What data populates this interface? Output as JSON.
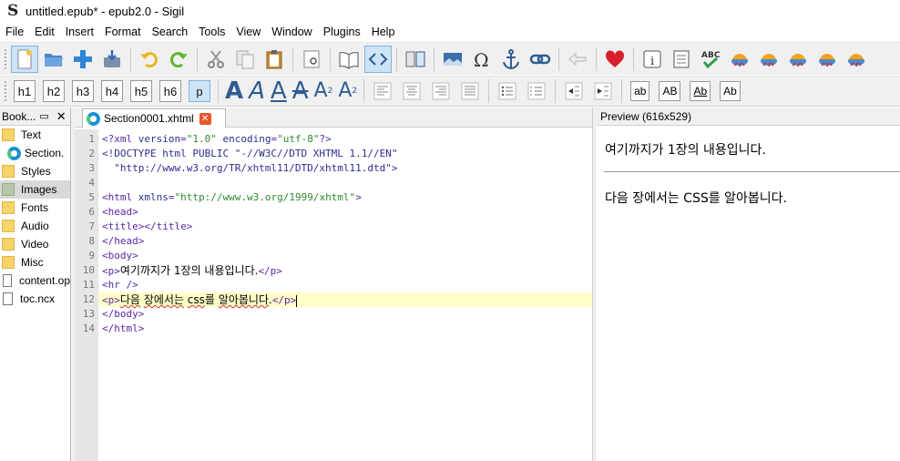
{
  "window": {
    "title": "untitled.epub* - epub2.0 - Sigil",
    "app_logo": "S"
  },
  "menu": [
    "File",
    "Edit",
    "Insert",
    "Format",
    "Search",
    "Tools",
    "View",
    "Window",
    "Plugins",
    "Help"
  ],
  "toolbar2": {
    "headings": [
      "h1",
      "h2",
      "h3",
      "h4",
      "h5",
      "h6",
      "p"
    ],
    "text_styles": [
      "A",
      "A",
      "A",
      "A",
      "A",
      "A"
    ],
    "subscript_mark": "2",
    "superscript_mark": "2",
    "case_buttons": [
      "ab",
      "AB",
      "Ab",
      "Ab"
    ]
  },
  "book_browser": {
    "title": "Book...",
    "items": [
      {
        "label": "Text",
        "kind": "folder"
      },
      {
        "label": "Section.",
        "kind": "xhtml"
      },
      {
        "label": "Styles",
        "kind": "folder"
      },
      {
        "label": "Images",
        "kind": "folder-selected"
      },
      {
        "label": "Fonts",
        "kind": "folder"
      },
      {
        "label": "Audio",
        "kind": "folder"
      },
      {
        "label": "Video",
        "kind": "folder"
      },
      {
        "label": "Misc",
        "kind": "folder"
      },
      {
        "label": "content.op",
        "kind": "file"
      },
      {
        "label": "toc.ncx",
        "kind": "file"
      }
    ]
  },
  "editor": {
    "tab_label": "Section0001.xhtml",
    "line_numbers": [
      "1",
      "2",
      "3",
      "4",
      "5",
      "6",
      "7",
      "8",
      "9",
      "10",
      "11",
      "12",
      "13",
      "14"
    ],
    "lines": {
      "l1": {
        "a": "<?xml ",
        "b": "version",
        "c": "=",
        "d": "\"1.0\"",
        "e": " ",
        "f": "encoding",
        "g": "=",
        "h": "\"utf-8\"",
        "i": "?>"
      },
      "l2": "<!DOCTYPE html PUBLIC \"-//W3C//DTD XHTML 1.1//EN\"",
      "l3": "  \"http://www.w3.org/TR/xhtml11/DTD/xhtml11.dtd\">",
      "l5": {
        "a": "<html ",
        "b": "xmlns",
        "c": "=",
        "d": "\"http://www.w3.org/1999/xhtml\"",
        "e": ">"
      },
      "l6": "<head>",
      "l7": "<title></title>",
      "l8": "</head>",
      "l9": "<body>",
      "l10": {
        "open": "<p>",
        "text": "여기까지가 1장의 내용입니다.",
        "close": "</p>"
      },
      "l11": "<hr />",
      "l12": {
        "open": "<p>",
        "t1": "다음",
        "t2": " ",
        "t3": "장에서는",
        "t4": " ",
        "t5": "css",
        "t6": "를",
        "t7": " ",
        "t8": "알아봅니다",
        "t9": ".",
        "close": "</p>"
      },
      "l13": "</body>",
      "l14": "</html>"
    }
  },
  "preview": {
    "title": "Preview (616x529)",
    "para1": "여기까지가 1장의 내용입니다.",
    "para2": "다음 장에서는 CSS를 알아봅니다."
  }
}
